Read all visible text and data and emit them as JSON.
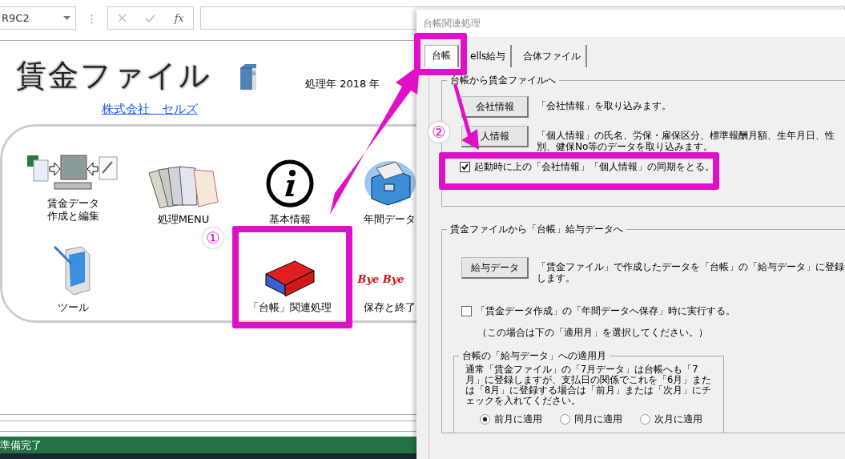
{
  "formula_bar": {
    "name_box": "R9C2",
    "function_label": "fx"
  },
  "sheet": {
    "title": "賃金ファイル",
    "year_label": "処理年  2018 年",
    "company_link": "株式会社　セルズ",
    "menu": [
      {
        "kind": "transfer",
        "label": "賃金データ",
        "label_2": "作成と編集"
      },
      {
        "kind": "documents",
        "label": "処理MENU"
      },
      {
        "kind": "info",
        "label": "基本情報"
      },
      {
        "kind": "cabinet",
        "label": "年間データ"
      },
      {
        "kind": "tablet",
        "label": "ツール"
      },
      {
        "kind": "binder",
        "label": "「台帳」関連処理"
      },
      {
        "kind": "byebye",
        "label": "保存と終了",
        "logo_text": "Bye Bye"
      }
    ]
  },
  "status_bar": {
    "text": "準備完了"
  },
  "dialog": {
    "title": "台帳関連処理",
    "tabs": [
      {
        "label": "台帳",
        "selected": true
      },
      {
        "label": "ells給与",
        "selected": false
      },
      {
        "label": "合体ファイル",
        "selected": false
      }
    ],
    "import_group": {
      "legend": "台帳から賃金ファイルへ",
      "actions": [
        {
          "button": "会社情報",
          "description": "「会社情報」を取り込みます。"
        },
        {
          "button": "人情報",
          "description": "「個人情報」の氏名、労保・雇保区分、標準報酬月額、生年月日、性別、健保No等のデータを取り込みます。"
        }
      ],
      "sync_checkbox": {
        "label": "起動時に上の「会社情報」「個人情報」の同期をとる。",
        "checked": true
      }
    },
    "export_group": {
      "legend": "賃金ファイルから「台帳」給与データへ",
      "button": "給与データ",
      "description": "「賃金ファイル」で作成したデータを「台帳」の「給与データ」に登録します。",
      "run_checkbox": {
        "label": "「賃金データ作成」の「年間データへ保存」時に実行する。",
        "checked": false
      },
      "note": "（この場合は下の「適用月」を選択してください。）",
      "month_group": {
        "legend": "台帳の「給与データ」への適用月",
        "text": "通常「賃金ファイル」の「7月データ」は台帳へも「7月」に登録しますが、支払日の関係でこれを「6月」または「8月」に登録する場合は「前月」または「次月」にチェックを入れてください。",
        "options": [
          {
            "label": "前月に適用",
            "selected": true
          },
          {
            "label": "同月に適用",
            "selected": false
          },
          {
            "label": "次月に適用",
            "selected": false
          }
        ]
      }
    }
  },
  "annotations": [
    {
      "number": "①"
    },
    {
      "number": "②"
    }
  ]
}
